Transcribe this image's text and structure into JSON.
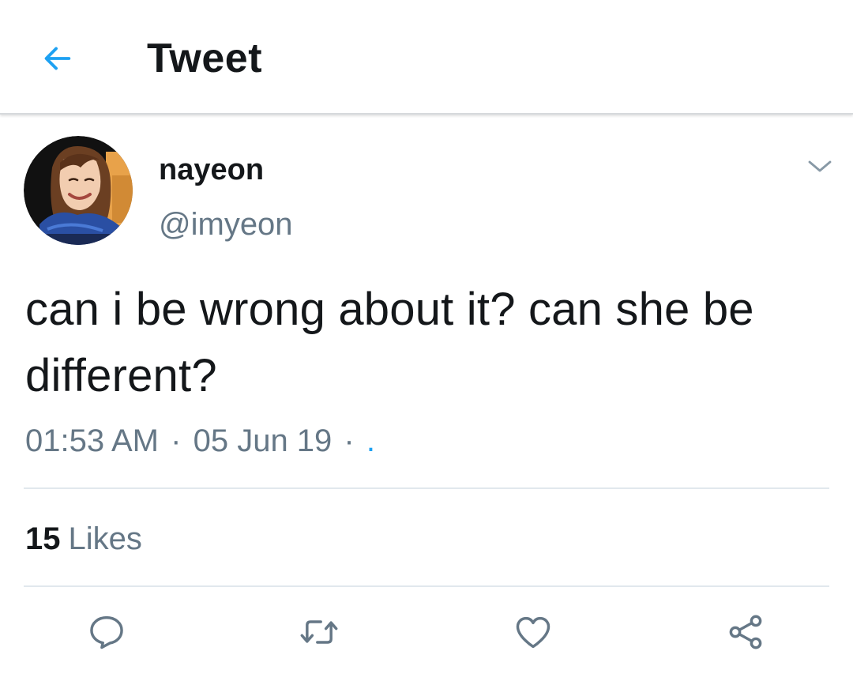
{
  "header": {
    "back_icon": "arrow-left-icon",
    "title": "Tweet"
  },
  "author": {
    "name": "nayeon",
    "handle": "@imyeon",
    "avatar": "profile-photo"
  },
  "tweet": {
    "text": "can i be wrong about it? can she be different?",
    "time": "01:53 AM",
    "separator": "·",
    "date": "05 Jun 19",
    "via": "."
  },
  "stats": {
    "likes_count": "15",
    "likes_label": "Likes"
  },
  "actions": [
    {
      "name": "reply",
      "icon": "reply-bubble-icon"
    },
    {
      "name": "retweet",
      "icon": "retweet-icon"
    },
    {
      "name": "like",
      "icon": "heart-icon"
    },
    {
      "name": "share",
      "icon": "share-icon"
    }
  ],
  "colors": {
    "accent": "#1da1f2",
    "text": "#14171a",
    "secondary_text": "#657786",
    "divider": "#e1e8ed",
    "icon_gray": "#657786"
  }
}
